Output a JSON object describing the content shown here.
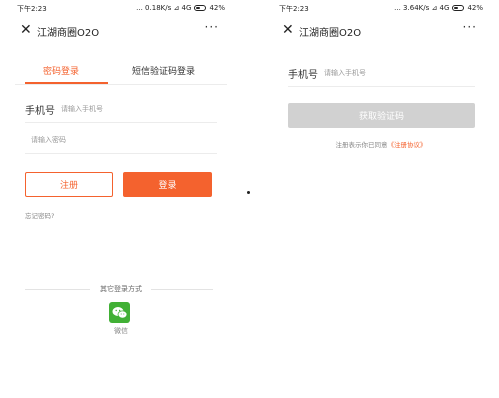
{
  "left": {
    "status": {
      "time": "下午2:23",
      "network": "... 0.18K/s ⊿ 4G ",
      "battery": "42%"
    },
    "nav": {
      "close": "✕",
      "title": "江湖商圈O2O",
      "more": "···"
    },
    "tabs": {
      "password_login": "密码登录",
      "sms_login": "短信验证码登录"
    },
    "phone_label": "手机号",
    "phone_placeholder": "请输入手机号",
    "password_placeholder": "请输入密码",
    "register_button": "注册",
    "login_button": "登录",
    "forgot_password": "忘记密码?",
    "other_login": "其它登录方式",
    "wechat_label": "微信"
  },
  "right": {
    "status": {
      "time": "下午2:23",
      "network": "... 3.64K/s ⊿ 4G ",
      "battery": "42%"
    },
    "nav": {
      "close": "✕",
      "title": "江湖商圈O2O",
      "more": "···"
    },
    "phone_label": "手机号",
    "phone_placeholder": "请输入手机号",
    "get_code_button": "获取验证码",
    "agreement_prefix": "注册表示你已同意",
    "agreement_link": "《注册协议》"
  },
  "colors": {
    "accent": "#f4622e",
    "wechat": "#41b035",
    "disabled": "#d1d1d1"
  }
}
